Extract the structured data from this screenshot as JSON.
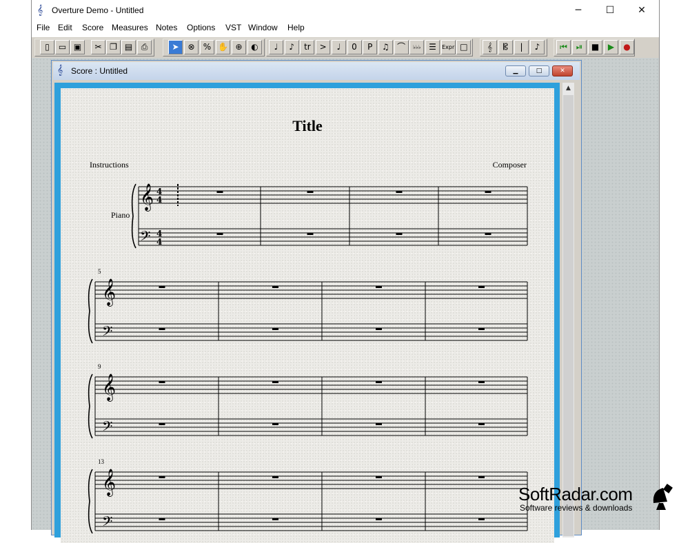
{
  "window": {
    "title": "Overture Demo - Untitled",
    "app_icon": "treble-clef-icon",
    "controls": {
      "minimize": "─",
      "maximize": "☐",
      "close": "✕"
    }
  },
  "menu": [
    "File",
    "Edit",
    "Score",
    "Measures",
    "Notes",
    "Options",
    "VST",
    "Window",
    "Help"
  ],
  "toolbar": {
    "file_group": [
      "new-document-icon",
      "open-folder-icon",
      "save-icon",
      "cut-icon",
      "copy-icon",
      "paste-icon",
      "print-icon"
    ],
    "tools_group": [
      {
        "name": "select-arrow-icon",
        "glyph": "➤",
        "selected": true
      },
      {
        "name": "erase-circle-icon",
        "glyph": "⊗"
      },
      {
        "name": "percent-icon",
        "glyph": "%"
      },
      {
        "name": "hand-icon",
        "glyph": "✋"
      },
      {
        "name": "zoom-icon",
        "glyph": "⊕"
      },
      {
        "name": "speaker-icon",
        "glyph": "◐"
      }
    ],
    "notes_group": [
      {
        "name": "quarter-note-icon",
        "glyph": "♩"
      },
      {
        "name": "tied-notes-icon",
        "glyph": "♪"
      },
      {
        "name": "trill-icon",
        "glyph": "tr"
      },
      {
        "name": "accent-icon",
        "glyph": ">"
      },
      {
        "name": "quarter-note-2-icon",
        "glyph": "♩"
      },
      {
        "name": "zero-icon",
        "glyph": "0"
      },
      {
        "name": "dynamic-p-icon",
        "glyph": "P"
      },
      {
        "name": "beamed-notes-icon",
        "glyph": "♫"
      },
      {
        "name": "slur-icon",
        "glyph": "⌒"
      },
      {
        "name": "chord-symbols-icon",
        "glyph": "♭♭♭"
      },
      {
        "name": "lyrics-icon",
        "glyph": "☰"
      },
      {
        "name": "expression-icon",
        "glyph": "Expr"
      },
      {
        "name": "box-icon",
        "glyph": "□"
      }
    ],
    "clef_group": [
      {
        "name": "treble-clef-icon",
        "glyph": "𝄞"
      },
      {
        "name": "clef-alt-icon",
        "glyph": "𝄡"
      },
      {
        "name": "barline-icon",
        "glyph": "|"
      },
      {
        "name": "notes-stack-icon",
        "glyph": "♪"
      }
    ],
    "transport_group": [
      {
        "name": "rewind-icon",
        "glyph": "⏮",
        "color": "#1a8a1a"
      },
      {
        "name": "step-play-icon",
        "glyph": "⏯",
        "color": "#1a8a1a"
      },
      {
        "name": "stop-icon",
        "glyph": "■",
        "color": "#000000"
      },
      {
        "name": "play-icon",
        "glyph": "▶",
        "color": "#1a8a1a"
      },
      {
        "name": "record-icon",
        "glyph": "●",
        "color": "#c01818"
      }
    ]
  },
  "score_window": {
    "title": "Score : Untitled",
    "icon": "treble-clef-icon",
    "controls": {
      "minimize": "▁",
      "maximize": "□",
      "close": "✕"
    }
  },
  "score": {
    "title": "Title",
    "instructions": "Instructions",
    "composer": "Composer",
    "instrument": "Piano",
    "time_signature": "4/4",
    "systems": [
      {
        "first_measure_label": "",
        "measures": 4
      },
      {
        "first_measure_label": "5",
        "measures": 4
      },
      {
        "first_measure_label": "9",
        "measures": 4
      },
      {
        "first_measure_label": "13",
        "measures": 4
      }
    ]
  },
  "watermark": {
    "name": "SoftRadar.com",
    "tagline": "Software reviews & downloads"
  },
  "colors": {
    "accent": "#2ea0dc",
    "toolbar": "#d4d0c8",
    "paper": "#ecebe7",
    "selected_tool": "#3a7bd5"
  }
}
